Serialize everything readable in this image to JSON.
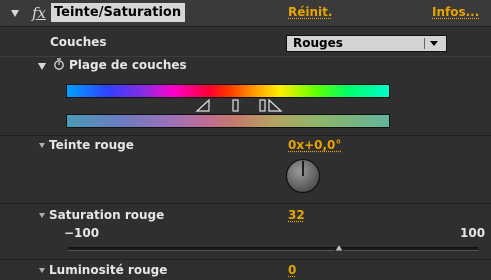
{
  "effect": {
    "fx_label": "fx",
    "name": "Teinte/Saturation",
    "reset_label": "Réinit.",
    "about_label": "Infos..."
  },
  "channel": {
    "label": "Couches",
    "selected": "Rouges"
  },
  "range": {
    "label": "Plage de couches"
  },
  "hue": {
    "label": "Teinte rouge",
    "value": "0x+0,0°"
  },
  "saturation": {
    "label": "Saturation rouge",
    "value": "32",
    "min_label": "−100",
    "max_label": "100",
    "min": -100,
    "max": 100,
    "current": 32
  },
  "lightness": {
    "label": "Luminosité rouge",
    "value": "0"
  },
  "colors": {
    "accent": "#e7a500",
    "panel": "#2f2f2f",
    "header": "#3a3a3a"
  }
}
